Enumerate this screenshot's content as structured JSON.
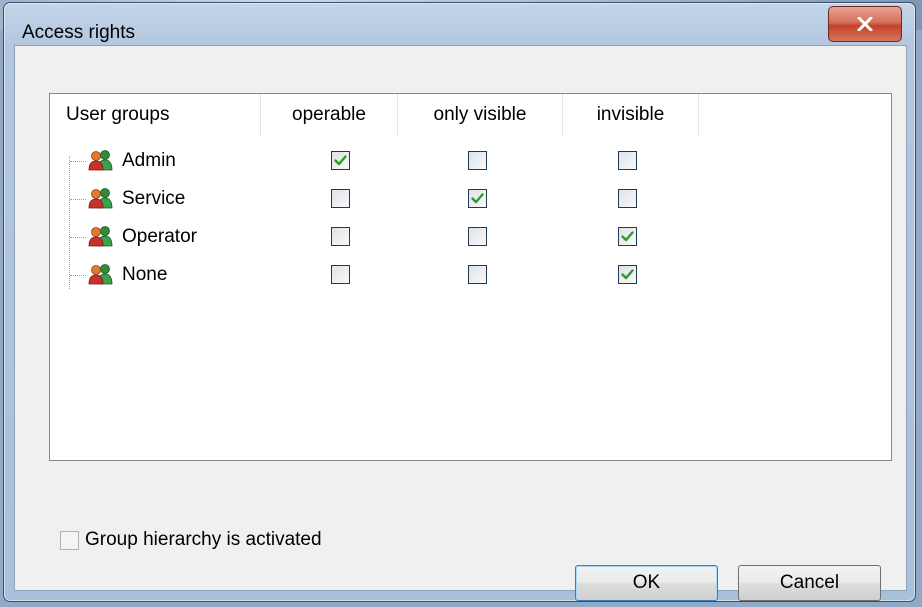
{
  "window": {
    "title": "Access rights"
  },
  "table": {
    "columns": [
      "User groups",
      "operable",
      "only visible",
      "invisible"
    ],
    "rows": [
      {
        "name": "Admin",
        "operable": true,
        "only_visible": false,
        "invisible": false
      },
      {
        "name": "Service",
        "operable": false,
        "only_visible": true,
        "invisible": false
      },
      {
        "name": "Operator",
        "operable": false,
        "only_visible": false,
        "invisible": true
      },
      {
        "name": "None",
        "operable": false,
        "only_visible": false,
        "invisible": true
      }
    ]
  },
  "options": {
    "group_hierarchy_label": "Group hierarchy is activated",
    "group_hierarchy_checked": false
  },
  "buttons": {
    "ok": "OK",
    "cancel": "Cancel"
  },
  "colors": {
    "check": "#2a9d2a",
    "close_button": "#c4412b"
  },
  "icons": {
    "close": "close-icon",
    "user_group": "user-group-icon"
  }
}
